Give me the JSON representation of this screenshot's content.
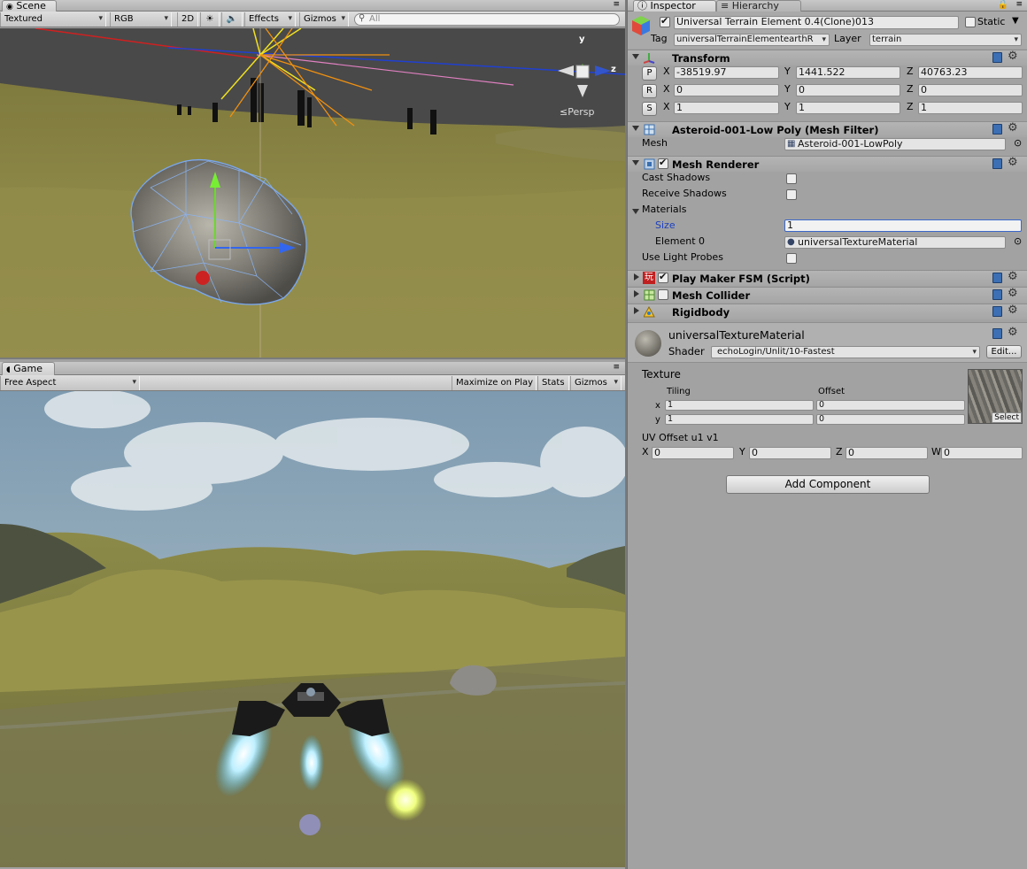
{
  "scene_tab": {
    "label": "Scene"
  },
  "scene_toolbar": {
    "render_mode": "Textured",
    "color_mode": "RGB",
    "mode_2d": "2D",
    "effects": "Effects",
    "gizmos": "Gizmos",
    "search_placeholder": "All"
  },
  "scene_gizmo": {
    "projection": "Persp",
    "y_label": "y",
    "z_label": "z"
  },
  "game_tab": {
    "label": "Game"
  },
  "game_toolbar": {
    "aspect": "Free Aspect",
    "maximize": "Maximize on Play",
    "stats": "Stats",
    "gizmos": "Gizmos"
  },
  "inspector_tabs": {
    "inspector": "Inspector",
    "hierarchy": "Hierarchy"
  },
  "object": {
    "name": "Universal Terrain Element 0.4(Clone)013",
    "active": true,
    "static_label": "Static",
    "tag_label": "Tag",
    "tag": "universalTerrainElementearthR",
    "layer_label": "Layer",
    "layer": "terrain"
  },
  "transform": {
    "title": "Transform",
    "p": "P",
    "r": "R",
    "s": "S",
    "x": "X",
    "y": "Y",
    "z": "Z",
    "position": {
      "x": "-38519.97",
      "y": "1441.522",
      "z": "40763.23"
    },
    "rotation": {
      "x": "0",
      "y": "0",
      "z": "0"
    },
    "scale": {
      "x": "1",
      "y": "1",
      "z": "1"
    }
  },
  "mesh_filter": {
    "title": "Asteroid-001-Low Poly (Mesh Filter)",
    "mesh_label": "Mesh",
    "mesh": "Asteroid-001-LowPoly"
  },
  "mesh_renderer": {
    "title": "Mesh Renderer",
    "enabled": true,
    "cast_shadows": "Cast Shadows",
    "receive_shadows": "Receive Shadows",
    "materials": "Materials",
    "size_label": "Size",
    "size": "1",
    "element0_label": "Element 0",
    "element0": "universalTextureMaterial",
    "use_light_probes": "Use Light Probes"
  },
  "playmaker": {
    "title": "Play Maker FSM (Script)",
    "enabled": true,
    "icon_glyph": "玩"
  },
  "mesh_collider": {
    "title": "Mesh Collider",
    "enabled": false
  },
  "rigidbody": {
    "title": "Rigidbody"
  },
  "material": {
    "name": "universalTextureMaterial",
    "shader_label": "Shader",
    "shader": "echoLogin/Unlit/10-Fastest",
    "edit": "Edit...",
    "texture_label": "Texture",
    "tiling_label": "Tiling",
    "offset_label": "Offset",
    "x": "x",
    "y": "y",
    "tiling": {
      "x": "1",
      "y": "1"
    },
    "offset": {
      "x": "0",
      "y": "0"
    },
    "select": "Select",
    "uv_label": "UV Offset u1 v1",
    "uv": {
      "x_label": "X",
      "x": "0",
      "y_label": "Y",
      "y": "0",
      "z_label": "Z",
      "z": "0",
      "w_label": "W",
      "w": "0"
    }
  },
  "add_component": "Add Component"
}
